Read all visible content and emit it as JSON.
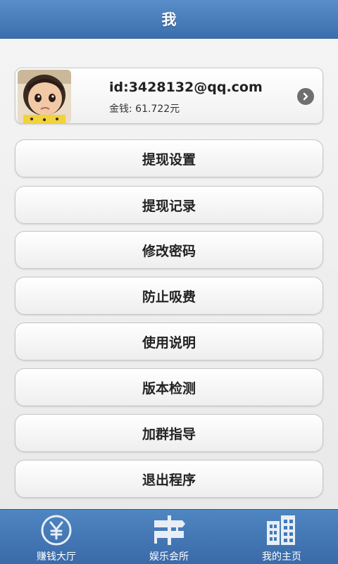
{
  "header": {
    "title": "我"
  },
  "profile": {
    "user_id": "id:3428132@qq.com",
    "balance": "金钱: 61.722元"
  },
  "menu": [
    {
      "label": "提现设置"
    },
    {
      "label": "提现记录"
    },
    {
      "label": "修改密码"
    },
    {
      "label": "防止吸费"
    },
    {
      "label": "使用说明"
    },
    {
      "label": "版本检测"
    },
    {
      "label": "加群指导"
    },
    {
      "label": "退出程序"
    }
  ],
  "tabs": [
    {
      "label": "赚钱大厅",
      "icon": "yen-coin-icon"
    },
    {
      "label": "娱乐会所",
      "icon": "signpost-icon"
    },
    {
      "label": "我的主页",
      "icon": "buildings-icon"
    }
  ],
  "colors": {
    "header": "#3f74b3",
    "tabbar": "#4479b7"
  }
}
